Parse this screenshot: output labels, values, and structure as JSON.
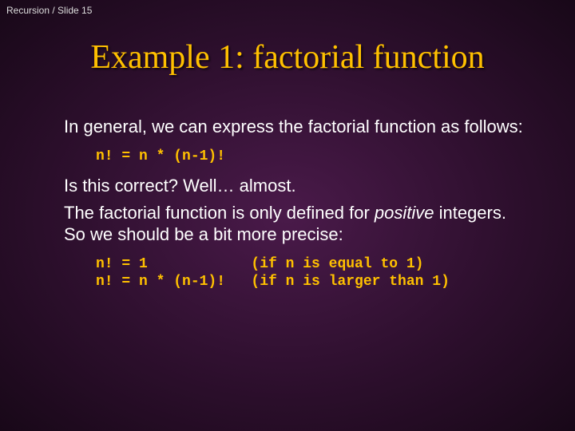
{
  "breadcrumb": "Recursion / Slide 15",
  "title": "Example 1: factorial function",
  "para1": "In general, we can express the factorial function as follows:",
  "code1": "n! = n * (n-1)!",
  "para2": "Is this correct? Well… almost.",
  "para3a": "The factorial function is only defined for ",
  "para3_italic": "positive",
  "para3b": " integers. So we should be a bit more precise:",
  "code2": "n! = 1            (if n is equal to 1)\nn! = n * (n-1)!   (if n is larger than 1)"
}
